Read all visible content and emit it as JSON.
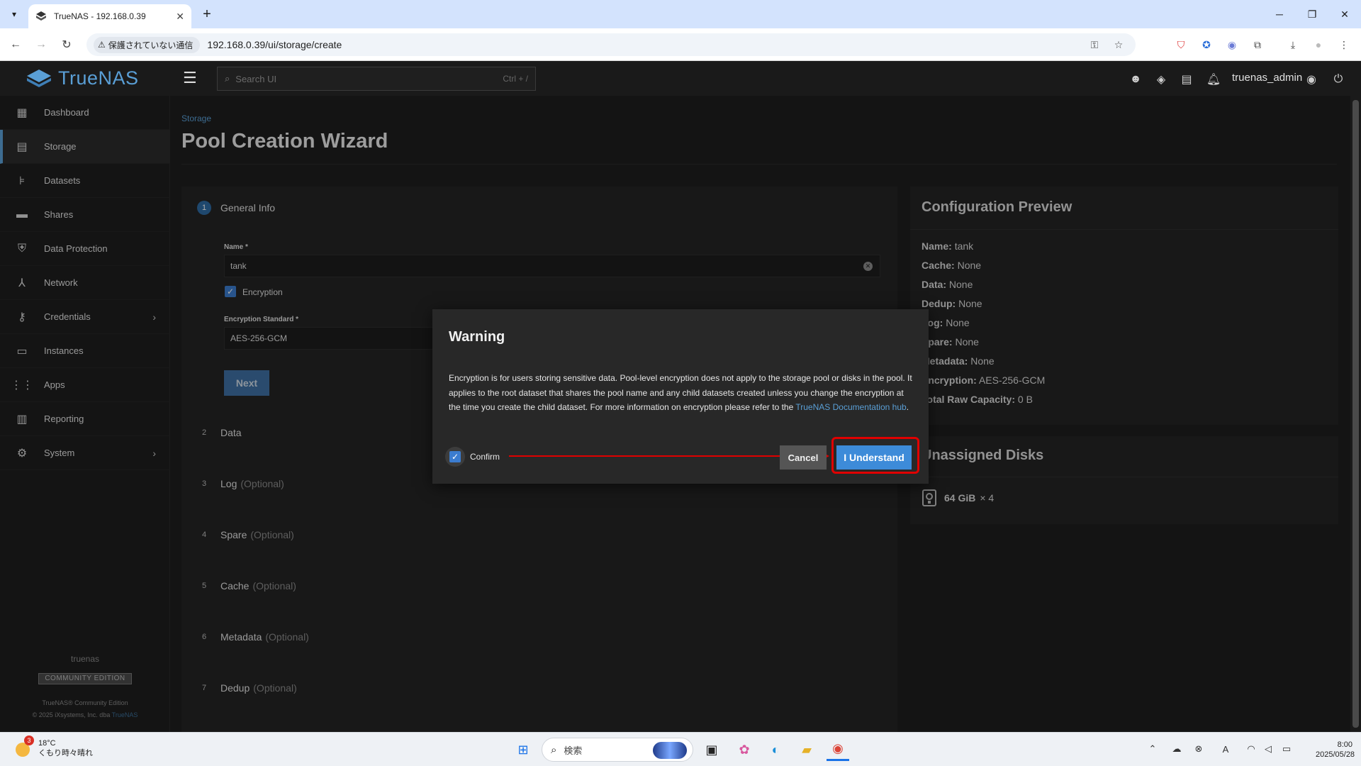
{
  "browser": {
    "tab_title": "TrueNAS - 192.168.0.39",
    "security_label": "保護されていない通信",
    "url": "192.168.0.39/ui/storage/create"
  },
  "topbar": {
    "logo_text": "TrueNAS",
    "search_placeholder": "Search UI",
    "search_shortcut": "Ctrl + /",
    "username": "truenas_admin"
  },
  "sidebar": {
    "items": [
      {
        "label": "Dashboard",
        "icon": "dashboard-icon"
      },
      {
        "label": "Storage",
        "icon": "storage-icon"
      },
      {
        "label": "Datasets",
        "icon": "datasets-icon"
      },
      {
        "label": "Shares",
        "icon": "shares-icon"
      },
      {
        "label": "Data Protection",
        "icon": "shield-icon"
      },
      {
        "label": "Network",
        "icon": "network-icon"
      },
      {
        "label": "Credentials",
        "icon": "key-icon"
      },
      {
        "label": "Instances",
        "icon": "laptop-icon"
      },
      {
        "label": "Apps",
        "icon": "apps-grid-icon"
      },
      {
        "label": "Reporting",
        "icon": "chart-icon"
      },
      {
        "label": "System",
        "icon": "gear-icon"
      }
    ],
    "hostname": "truenas",
    "edition": "COMMUNITY EDITION",
    "copyright_line1": "TrueNAS® Community Edition",
    "copyright_line2": "© 2025 iXsystems, Inc. dba",
    "copyright_link": "TrueNAS"
  },
  "main": {
    "breadcrumb": "Storage",
    "title": "Pool Creation Wizard",
    "steps": [
      {
        "num": "1",
        "label": "General Info",
        "optional": ""
      },
      {
        "num": "2",
        "label": "Data",
        "optional": ""
      },
      {
        "num": "3",
        "label": "Log",
        "optional": "(Optional)"
      },
      {
        "num": "4",
        "label": "Spare",
        "optional": "(Optional)"
      },
      {
        "num": "5",
        "label": "Cache",
        "optional": "(Optional)"
      },
      {
        "num": "6",
        "label": "Metadata",
        "optional": "(Optional)"
      },
      {
        "num": "7",
        "label": "Dedup",
        "optional": "(Optional)"
      }
    ],
    "form": {
      "name_label": "Name",
      "name_value": "tank",
      "encryption_label": "Encryption",
      "encryption_checked": true,
      "standard_label": "Encryption Standard",
      "standard_value": "AES-256-GCM",
      "next_label": "Next"
    }
  },
  "preview": {
    "title": "Configuration Preview",
    "rows": [
      {
        "key": "Name:",
        "value": "tank"
      },
      {
        "key": "Cache:",
        "value": "None"
      },
      {
        "key": "Data:",
        "value": "None"
      },
      {
        "key": "Dedup:",
        "value": "None"
      },
      {
        "key": "Log:",
        "value": "None"
      },
      {
        "key": "Spare:",
        "value": "None"
      },
      {
        "key": "Metadata:",
        "value": "None"
      },
      {
        "key": "Encryption:",
        "value": "AES-256-GCM"
      },
      {
        "key": "Total Raw Capacity:",
        "value": "0 B"
      }
    ]
  },
  "unassigned": {
    "title": "Unassigned Disks",
    "disk_size": "64 GiB",
    "disk_count": "× 4"
  },
  "dialog": {
    "title": "Warning",
    "body": "Encryption is for users storing sensitive data. Pool-level encryption does not apply to the storage pool or disks in the pool. It applies to the root dataset that shares the pool name and any child datasets created unless you change the encryption at the time you create the child dataset. For more information on encryption please refer to the ",
    "body_link": "TrueNAS Documentation hub",
    "body_end": ".",
    "confirm_label": "Confirm",
    "cancel_label": "Cancel",
    "ok_label": "I Understand",
    "highlight_color": "#e00000"
  },
  "taskbar": {
    "weather_badge": "3",
    "temperature": "18°C",
    "weather_text": "くもり時々晴れ",
    "search_text": "検索",
    "time": "8:00",
    "date": "2025/05/28"
  },
  "colors": {
    "accent": "#5a9fd6",
    "primary_button": "#3d8bd9",
    "background": "#1e1e1e"
  }
}
